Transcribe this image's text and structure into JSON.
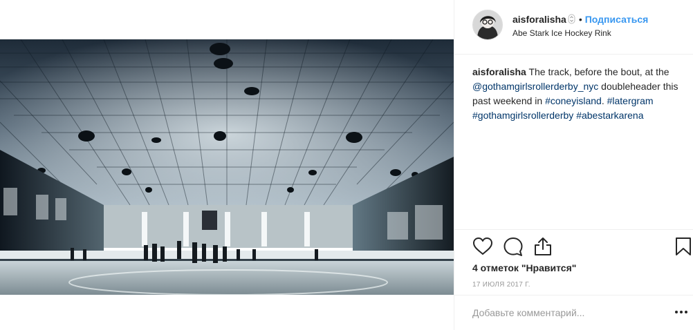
{
  "post": {
    "username": "aisforalisha",
    "separator": "•",
    "follow_label": "Подписаться",
    "location": "Abe Stark Ice Hockey Rink",
    "caption": {
      "username": "aisforalisha",
      "text_1": " The track, before the bout, at the ",
      "mention": "@gothamgirlsrollerderby_nyc",
      "text_2": " doubleheader this past weekend in ",
      "hashtag_1": "#coneyisland",
      "text_3": ". ",
      "hashtag_2": "#latergram",
      "hashtag_3": "#gothamgirlsrollerderby",
      "hashtag_4": "#abestarkarena"
    },
    "likes_label": "4 отметок \"Нравится\"",
    "date_label": "17 ИЮЛЯ 2017 Г.",
    "comment_placeholder": "Добавьте комментарий...",
    "more_label": "•••"
  },
  "icons": {
    "avatar": "user-avatar",
    "verified": "verified-icon",
    "like": "heart-icon",
    "comment": "comment-icon",
    "share": "share-icon",
    "save": "bookmark-icon",
    "more": "more-options-icon"
  },
  "colors": {
    "link": "#003569",
    "follow": "#3897f0",
    "muted": "#999999",
    "border": "#efefef"
  }
}
